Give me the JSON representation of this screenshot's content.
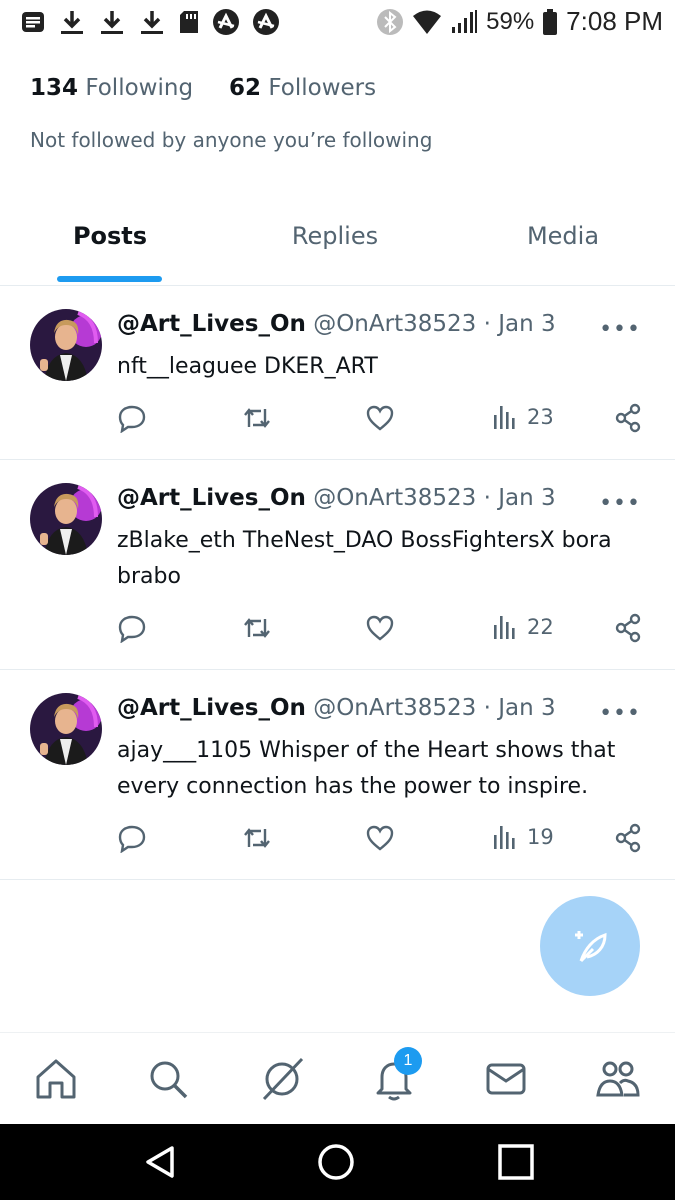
{
  "status_bar": {
    "battery": "59%",
    "time": "7:08 PM"
  },
  "profile": {
    "following_count": "134",
    "following_label": "Following",
    "followers_count": "62",
    "followers_label": "Followers",
    "not_followed_text": "Not followed by anyone you’re following"
  },
  "tabs": [
    {
      "label": "Posts",
      "active": true
    },
    {
      "label": "Replies",
      "active": false
    },
    {
      "label": "Media",
      "active": false
    }
  ],
  "posts": [
    {
      "display_name": "@Art_Lives_On",
      "handle_date": "@OnArt38523 · Jan 3",
      "text": "nft__leaguee DKER_ART",
      "views": "23"
    },
    {
      "display_name": "@Art_Lives_On",
      "handle_date": "@OnArt38523 · Jan 3",
      "text": "zBlake_eth TheNest_DAO BossFightersX bora brabo",
      "views": "22"
    },
    {
      "display_name": "@Art_Lives_On",
      "handle_date": "@OnArt38523 · Jan 3",
      "text": "ajay___1105 Whisper of the Heart shows that every connection has the power to inspire.",
      "views": "19"
    }
  ],
  "bottom_nav": {
    "items": [
      "home-icon",
      "search-icon",
      "grok-icon",
      "notifications-icon",
      "messages-icon",
      "communities-icon"
    ],
    "notification_badge": "1"
  },
  "colors": {
    "accent": "#1d9bf0",
    "fab": "#a6d3f8",
    "secondary_text": "#536471"
  }
}
